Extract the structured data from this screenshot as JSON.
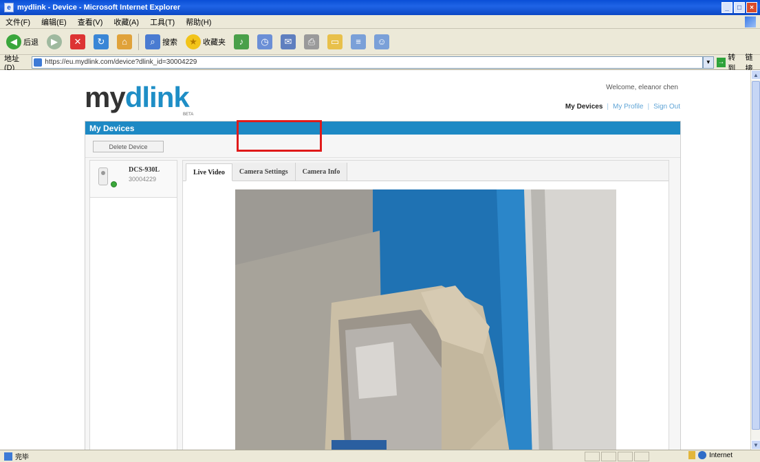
{
  "window": {
    "title": "mydlink - Device - Microsoft Internet Explorer",
    "min_label": "_",
    "max_label": "□",
    "close_label": "×"
  },
  "menu": [
    "文件(F)",
    "编辑(E)",
    "查看(V)",
    "收藏(A)",
    "工具(T)",
    "帮助(H)"
  ],
  "toolbar": {
    "back_label": "后退",
    "search_label": "搜索",
    "favorites_label": "收藏夹"
  },
  "address": {
    "label": "地址(D)",
    "url": "https://eu.mydlink.com/device?dlink_id=30004229",
    "go_label": "转到",
    "links_label": "链接"
  },
  "page": {
    "logo_my": "my",
    "logo_dlink": "dlink",
    "logo_sub": "BETA",
    "welcome": "Welcome, eleanor chen",
    "nav": {
      "my_devices": "My Devices",
      "my_profile": "My Profile",
      "sign_out": "Sign Out",
      "sep": "|"
    },
    "panel_title": "My Devices",
    "delete_button": "Delete Device",
    "device": {
      "name": "DCS-930L",
      "id": "30004229",
      "status": "online"
    },
    "tabs": [
      "Live Video",
      "Camera Settings",
      "Camera Info"
    ],
    "active_tab": "Live Video"
  },
  "status": {
    "text": "完毕",
    "zone": "Internet"
  },
  "colors": {
    "brand_blue": "#1d89c4",
    "highlight_red": "#e01a1a",
    "online_green": "#3aa83a"
  }
}
